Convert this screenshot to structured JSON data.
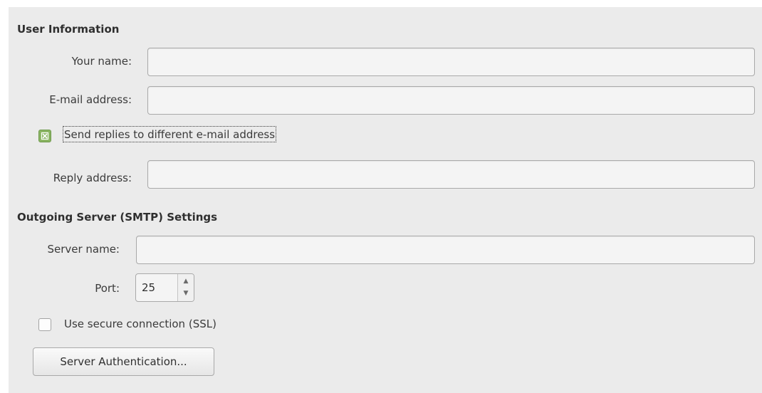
{
  "user_info": {
    "heading": "User Information",
    "name_label": "Your name:",
    "name_value": "",
    "email_label": "E-mail address:",
    "email_value": "",
    "reply_checkbox_label": "Send replies to different e-mail address",
    "reply_checkbox_checked": true,
    "reply_label": "Reply address:",
    "reply_value": ""
  },
  "smtp": {
    "heading": "Outgoing Server (SMTP) Settings",
    "server_label": "Server name:",
    "server_value": "",
    "port_label": "Port:",
    "port_value": "25",
    "ssl_label": "Use secure connection (SSL)",
    "ssl_checked": false,
    "auth_button": "Server Authentication..."
  },
  "icons": {
    "spin_up": "▲",
    "spin_down": "▼",
    "check_mark": "check-icon"
  },
  "colors": {
    "checkbox_on": "#8ab463",
    "panel_bg": "#ebebeb"
  }
}
